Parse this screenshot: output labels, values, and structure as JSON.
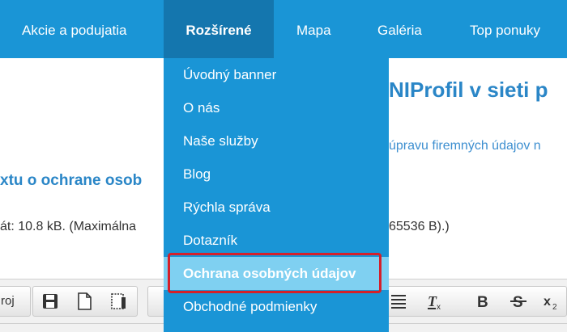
{
  "topnav": {
    "items": [
      {
        "label": "Akcie a podujatia"
      },
      {
        "label": "Rozšírené"
      },
      {
        "label": "Mapa"
      },
      {
        "label": "Galéria"
      },
      {
        "label": "Top ponuky"
      }
    ]
  },
  "content": {
    "heading_fragment": "NIProfil v sieti p",
    "link_fragment": "úpravu firemných údajov n",
    "section_heading_fragment": "xtu o ochrane osob",
    "size_info_left": "át: 10.8 kB. (Maximálna",
    "size_info_right": "65536 B).)"
  },
  "toolbar": {
    "left_text": "roj"
  },
  "dropdown": {
    "items": [
      {
        "label": "Úvodný banner"
      },
      {
        "label": "O nás"
      },
      {
        "label": "Naše služby"
      },
      {
        "label": "Blog"
      },
      {
        "label": "Rýchla správa"
      },
      {
        "label": "Dotazník"
      },
      {
        "label": "Ochrana osobných údajov"
      },
      {
        "label": "Obchodné podmienky"
      }
    ]
  },
  "colors": {
    "nav_bg": "#1a95d6",
    "nav_active_bg": "#1476ae",
    "dropdown_highlight": "#7fd0f1",
    "annotation_red": "#d4202a",
    "heading_blue": "#2a86c7"
  }
}
